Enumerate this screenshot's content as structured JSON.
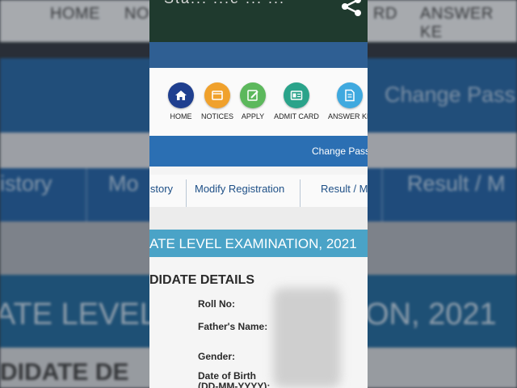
{
  "background": {
    "top_nav": [
      "HOME",
      "NO",
      "RD",
      "ANSWER KE"
    ],
    "change_password": "Change Pass",
    "tabs": [
      "istory",
      "Mo",
      "Result / M"
    ],
    "exam_banner": [
      "ATE LEVEL",
      "ON, 2021"
    ],
    "section_head": "DIDATE DE"
  },
  "phone": {
    "app_title": "Sta... ...e ... ...",
    "share_icon": "share-icon",
    "nav_icons": [
      {
        "label": "HOME",
        "icon": "home-icon",
        "color": "#1f3f8f"
      },
      {
        "label": "NOTICES",
        "icon": "notices-icon",
        "color": "#f0a12c"
      },
      {
        "label": "APPLY",
        "icon": "apply-icon",
        "color": "#5cb85c"
      },
      {
        "label": "ADMIT CARD",
        "icon": "admit-card-icon",
        "color": "#2aa38a"
      },
      {
        "label": "ANSWER KE",
        "icon": "answer-key-icon",
        "color": "#3fa9df"
      }
    ],
    "change_password": "Change Pass",
    "tabs": [
      "istory",
      "Modify Registration",
      "Result / M"
    ],
    "exam_title": "ATE LEVEL EXAMINATION, 2021",
    "candidate_heading": "DIDATE DETAILS",
    "fields": {
      "roll_no": "Roll No:",
      "father_name": "Father's Name:",
      "gender": "Gender:",
      "dob_line1": "Date of Birth",
      "dob_line2": "(DD-MM-YYYY):"
    },
    "colors": {
      "app_bar": "#1f3a2e",
      "nav_strip": "#2f5f93",
      "change_password_bar": "#2b6fb3",
      "exam_banner": "#4aa3c7",
      "tab_text": "#1d4f86"
    }
  }
}
